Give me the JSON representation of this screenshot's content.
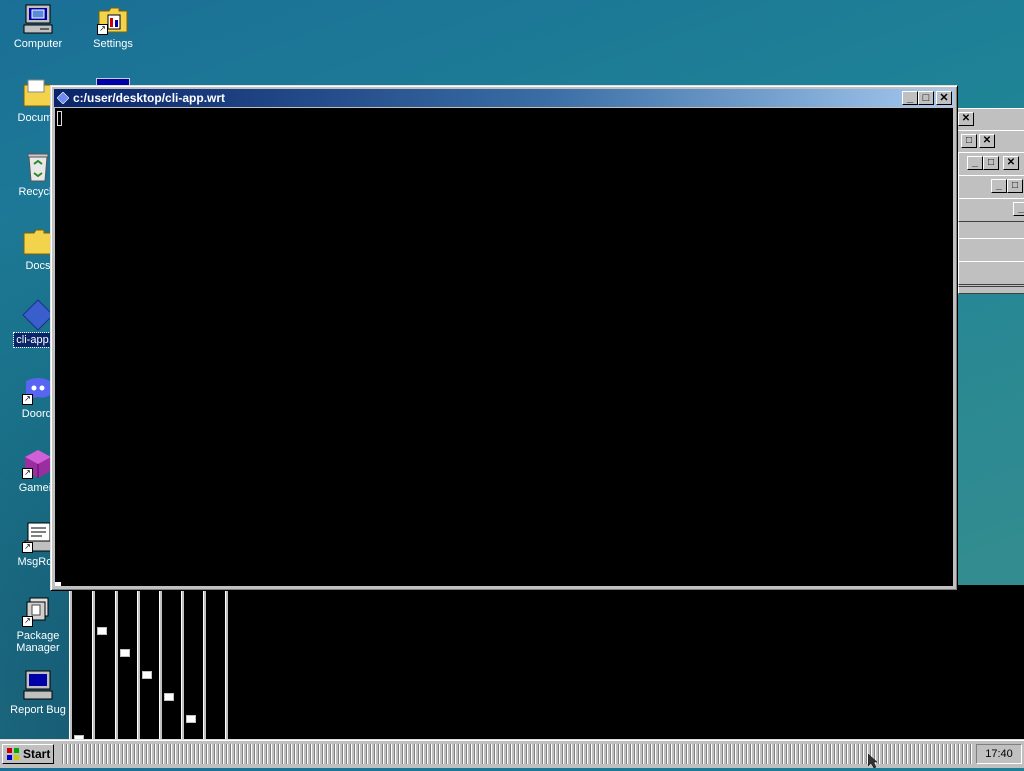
{
  "desktop": {
    "icons": [
      {
        "label": "Computer",
        "icon": "computer-icon"
      },
      {
        "label": "Settings",
        "icon": "settings-folder-icon"
      },
      {
        "label": "Docume",
        "icon": "documents-folder-icon"
      },
      {
        "label": "Recycle",
        "icon": "recycle-bin-icon"
      },
      {
        "label": "Docs",
        "icon": "folder-icon"
      },
      {
        "label": "cli-app.w",
        "icon": "diamond-app-icon"
      },
      {
        "label": "Doordi",
        "icon": "chat-app-icon"
      },
      {
        "label": "Gamein",
        "icon": "game-cube-icon"
      },
      {
        "label": "MsgRoo",
        "icon": "message-icon"
      },
      {
        "label": "Package Manager",
        "icon": "package-icon"
      },
      {
        "label": "Report Bug",
        "icon": "monitor-bug-icon"
      }
    ]
  },
  "main_window": {
    "title": "c:/user/desktop/cli-app.wrt",
    "minimize": "_",
    "maximize": "□",
    "close": "✕"
  },
  "taskbar": {
    "start_label": "Start",
    "clock": "17:40"
  },
  "colors": {
    "desktop": "#1f8396",
    "titlebar_start": "#0a246a",
    "titlebar_end": "#a6caf0",
    "chrome": "#c0c0c0",
    "terminal": "#000000"
  }
}
